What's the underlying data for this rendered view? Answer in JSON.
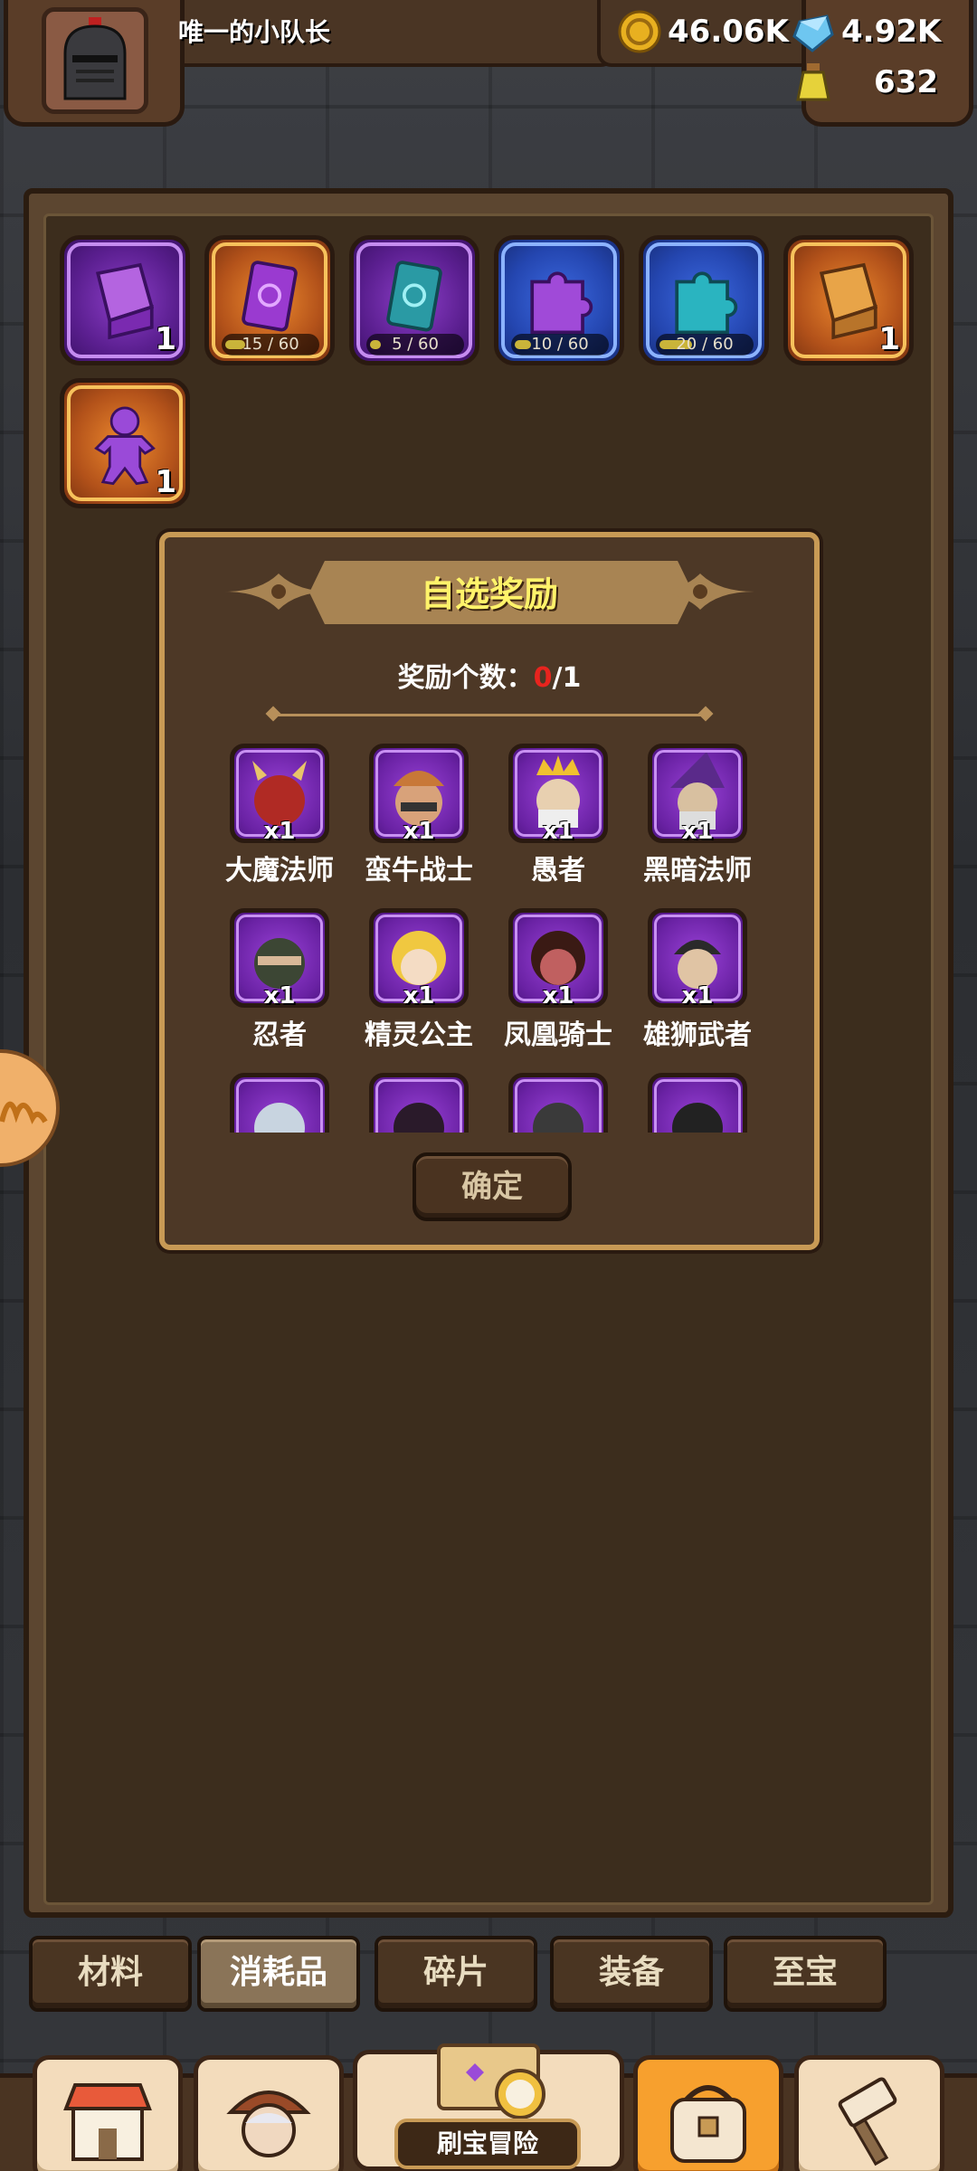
{
  "player": {
    "name": "唯一的小队长"
  },
  "resources": {
    "gold": "46.06K",
    "gems": "4.92K",
    "potion": "632"
  },
  "inventory": [
    {
      "rarity": "purple",
      "icon": "puzzle-box-icon",
      "count": "1"
    },
    {
      "rarity": "orange",
      "icon": "card-icon",
      "progress": "15 / 60",
      "fill": 0.25
    },
    {
      "rarity": "purple",
      "icon": "card-icon",
      "progress": "5 / 60",
      "fill": 0.08
    },
    {
      "rarity": "blue",
      "icon": "puzzle-piece-icon",
      "progress": "10 / 60",
      "fill": 0.17
    },
    {
      "rarity": "blue",
      "icon": "puzzle-piece-icon",
      "progress": "20 / 60",
      "fill": 0.33
    },
    {
      "rarity": "orange",
      "icon": "puzzle-box-icon",
      "count": "1"
    },
    {
      "rarity": "orange",
      "icon": "gingerbread-icon",
      "count": "1"
    }
  ],
  "dialog": {
    "title": "自选奖励",
    "count_label": "奖励个数：",
    "count_selected": "0",
    "count_total": "/1",
    "confirm": "确定",
    "heroes": [
      {
        "name": "大魔法师",
        "qty": "x1"
      },
      {
        "name": "蛮牛战士",
        "qty": "x1"
      },
      {
        "name": "愚者",
        "qty": "x1"
      },
      {
        "name": "黑暗法师",
        "qty": "x1"
      },
      {
        "name": "忍者",
        "qty": "x1"
      },
      {
        "name": "精灵公主",
        "qty": "x1"
      },
      {
        "name": "凤凰骑士",
        "qty": "x1"
      },
      {
        "name": "雄狮武者",
        "qty": "x1"
      },
      {
        "name": "",
        "qty": ""
      },
      {
        "name": "",
        "qty": ""
      },
      {
        "name": "",
        "qty": ""
      },
      {
        "name": "",
        "qty": ""
      }
    ]
  },
  "tabs": [
    {
      "label": "材料",
      "active": false
    },
    {
      "label": "消耗品",
      "active": true
    },
    {
      "label": "碎片",
      "active": false
    },
    {
      "label": "装备",
      "active": false
    },
    {
      "label": "至宝",
      "active": false
    }
  ],
  "bottom_nav": {
    "shop": "shop-icon",
    "heroes": "hero-icon",
    "adventure": "刷宝冒险",
    "bag": "bag-icon",
    "forge": "forge-icon"
  },
  "colors": {
    "accent": "#f7a02e",
    "title": "#fff36a",
    "zero_count": "#e8241e"
  }
}
